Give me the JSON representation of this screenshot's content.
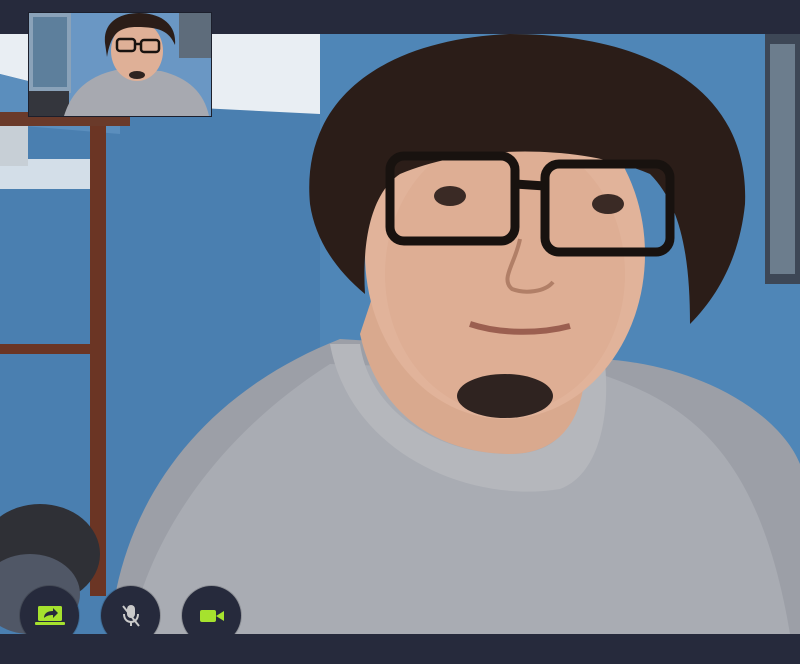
{
  "app": {
    "accent_color": "#a6e22e",
    "bar_color": "#262a3c"
  },
  "remote_participant": {
    "video_state": "active"
  },
  "self_view": {
    "video_state": "active"
  },
  "controls": [
    {
      "id": "share-screen",
      "icon": "share-screen-icon",
      "state": "on"
    },
    {
      "id": "microphone",
      "icon": "microphone-muted-icon",
      "state": "muted"
    },
    {
      "id": "camera",
      "icon": "video-camera-icon",
      "state": "on"
    }
  ]
}
